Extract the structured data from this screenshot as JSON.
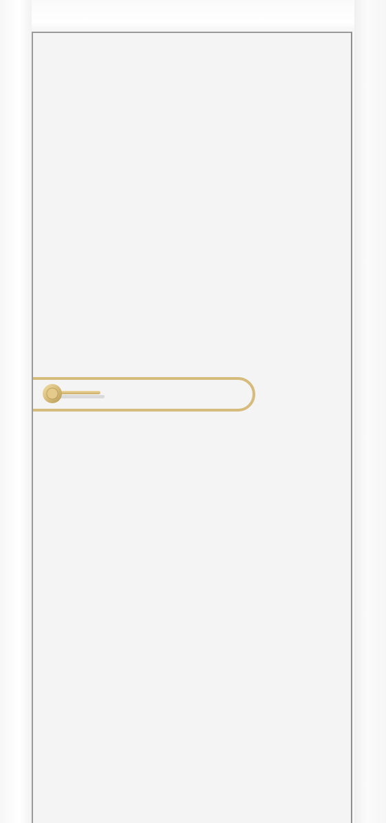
{
  "scene": {
    "subject": "interior-door",
    "colors": {
      "door_leaf": "#f4f4f4",
      "frame": "#ffffff",
      "edge_line": "#9a9a9a",
      "inlay_gold": "#d9bf7c",
      "handle_gold": "#dcc384"
    },
    "icons": [
      "door-handle-icon",
      "rosette-icon"
    ]
  }
}
